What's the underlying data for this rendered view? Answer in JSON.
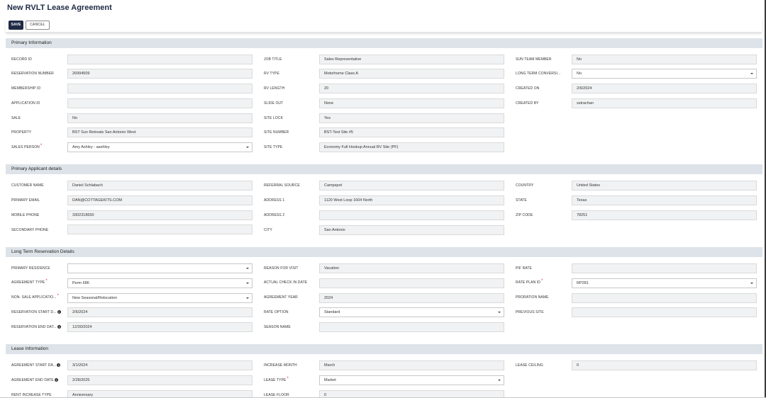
{
  "page": {
    "title": "New RVLT Lease Agreement"
  },
  "toolbar": {
    "save_label": "SAVE",
    "cancel_label": "CANCEL"
  },
  "sections": {
    "primary_info": "Primary Information",
    "applicant": "Primary Applicant details",
    "reservation": "Long Term Reservation Details",
    "lease": "Lease Information"
  },
  "primary": {
    "record_id": {
      "label": "RECORD ID",
      "value": ""
    },
    "reservation_number": {
      "label": "RESERVATION NUMBER",
      "value": "26994509"
    },
    "membership_id": {
      "label": "MEMBERSHIP ID",
      "value": ""
    },
    "application_id": {
      "label": "APPLICATION ID",
      "value": ""
    },
    "sale": {
      "label": "SALE",
      "value": "No"
    },
    "property": {
      "label": "PROPERTY",
      "value": "BST Sun Retreats San Antonio West"
    },
    "sales_person": {
      "label": "SALES PERSON",
      "value": "Amy Ashley - aashley"
    },
    "job_title": {
      "label": "JOB TITLE",
      "value": "Sales Representative"
    },
    "rv_type": {
      "label": "RV TYPE",
      "value": "Motorhome Class A"
    },
    "rv_length": {
      "label": "RV LENGTH",
      "value": "20"
    },
    "slide_out": {
      "label": "SLIDE OUT",
      "value": "None"
    },
    "site_lock": {
      "label": "SITE LOCK",
      "value": "Yes"
    },
    "site_number": {
      "label": "SITE NUMBER",
      "value": "BST-Test Site #5"
    },
    "site_type": {
      "label": "SITE TYPE",
      "value": "Economy Full Hookup Annual RV Site (PF)"
    },
    "sun_team_member": {
      "label": "SUN TEAM MEMBER",
      "value": "No"
    },
    "long_term_conversion": {
      "label": "LONG TERM CONVERSI...",
      "value": "No"
    },
    "created_on": {
      "label": "CREATED ON",
      "value": "2/6/2024"
    },
    "created_by": {
      "label": "CREATED BY",
      "value": "sstrachan"
    }
  },
  "applicant": {
    "customer_name": {
      "label": "CUSTOMER NAME",
      "value": "Daniel Schlabach"
    },
    "primary_email": {
      "label": "PRIMARY EMAIL",
      "value": "DAN@COTTAGEKITS.COM"
    },
    "mobile_phone": {
      "label": "MOBILE PHONE",
      "value": "3302318650"
    },
    "secondary_phone": {
      "label": "SECONDARY PHONE",
      "value": ""
    },
    "referral_source": {
      "label": "REFERRAL SOURCE",
      "value": "Campspot"
    },
    "address1": {
      "label": "ADDRESS 1",
      "value": "1120 West Loop 1604 North"
    },
    "address2": {
      "label": "ADDRESS 2",
      "value": ""
    },
    "city": {
      "label": "CITY",
      "value": "San Antonio"
    },
    "country": {
      "label": "COUNTRY",
      "value": "United States"
    },
    "state": {
      "label": "STATE",
      "value": "Texas"
    },
    "zip_code": {
      "label": "ZIP CODE",
      "value": "78251"
    }
  },
  "reservation": {
    "primary_residence": {
      "label": "PRIMARY RESIDENCE",
      "value": ""
    },
    "agreement_type": {
      "label": "AGREEMENT TYPE",
      "value": "Perm 686"
    },
    "non_sale_application": {
      "label": "NON- SALE APPLICATIO...",
      "value": "New Seasonal/Relocation"
    },
    "reservation_start": {
      "label": "RESERVATION START D...",
      "value": "2/6/2024"
    },
    "reservation_end": {
      "label": "RESERVATION END DAT...",
      "value": "12/30/2024"
    },
    "reason_for_visit": {
      "label": "REASON FOR VISIT",
      "value": "Vacation"
    },
    "actual_check_in": {
      "label": "ACTUAL CHECK IN DATE",
      "value": ""
    },
    "agreement_year": {
      "label": "AGREEMENT YEAR",
      "value": "2024"
    },
    "rate_option": {
      "label": "RATE OPTION",
      "value": "Standard"
    },
    "season_name": {
      "label": "SEASON NAME",
      "value": ""
    },
    "pif_rate": {
      "label": "PIF RATE",
      "value": ""
    },
    "rate_plan_id": {
      "label": "RATE PLAN ID",
      "value": "RP281"
    },
    "proration_name": {
      "label": "PRORATION NAME",
      "value": ""
    },
    "previous_site": {
      "label": "PREVIOUS SITE",
      "value": ""
    }
  },
  "lease": {
    "agreement_start": {
      "label": "AGREEMENT START DA...",
      "value": "3/1/2024"
    },
    "agreement_end": {
      "label": "AGREEMENT END DATE",
      "value": "2/28/2025"
    },
    "rent_increase_type": {
      "label": "RENT INCREASE TYPE",
      "value": "Anniversary"
    },
    "increase_month": {
      "label": "INCREASE MONTH",
      "value": "March"
    },
    "lease_type": {
      "label": "LEASE TYPE",
      "value": "Market"
    },
    "lease_floor": {
      "label": "LEASE FLOOR",
      "value": "0"
    },
    "lease_ceiling": {
      "label": "LEASE CEILING",
      "value": "0"
    }
  }
}
